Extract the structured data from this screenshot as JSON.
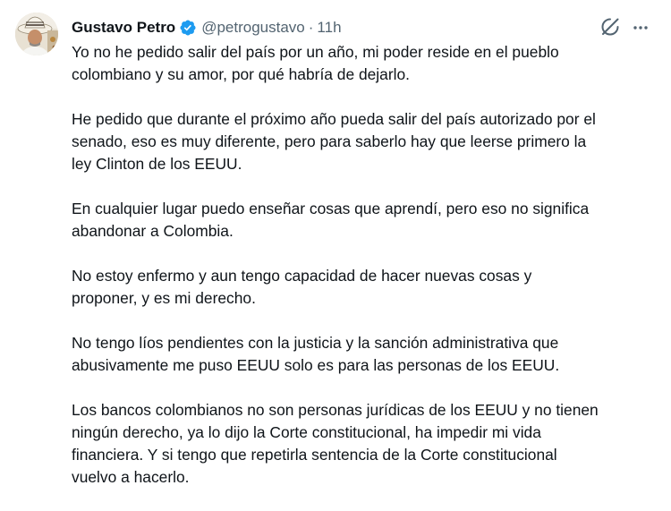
{
  "tweet": {
    "author_name": "Gustavo Petro",
    "handle": "@petrogustavo",
    "separator": "·",
    "time": "11h",
    "paragraphs": [
      "Yo no he pedido salir del país por un año, mi poder reside en el pueblo\ncolombiano y su amor, por qué habría de dejarlo.",
      "He pedido que durante el próximo año pueda salir del país autorizado por el\nsenado, eso es muy diferente, pero para saberlo hay que leerse primero la\nley Clinton de los EEUU.",
      "En cualquier lugar puedo enseñar cosas que aprendí, pero eso no significa\nabandonar a Colombia.",
      "No estoy enfermo y aun tengo capacidad de hacer nuevas cosas y\nproponer, y es mi derecho.",
      "No tengo líos pendientes con la justicia y la sanción administrativa que\nabusivamente me puso EEUU solo es para las personas de los EEUU.",
      "Los bancos colombianos no son personas jurídicas de los EEUU y no tienen\nningún derecho, ya lo dijo la Corte constitucional, ha impedir mi vida\nfinanciera. Y si tengo que repetirla sentencia de la Corte constitucional\nvuelvo a hacerlo."
    ]
  },
  "icons": {
    "verified": "verified-badge-icon",
    "grok": "grok-icon",
    "more": "more-options-icon"
  },
  "colors": {
    "text": "#0f1419",
    "secondary": "#536471",
    "verified": "#1d9bf0"
  }
}
